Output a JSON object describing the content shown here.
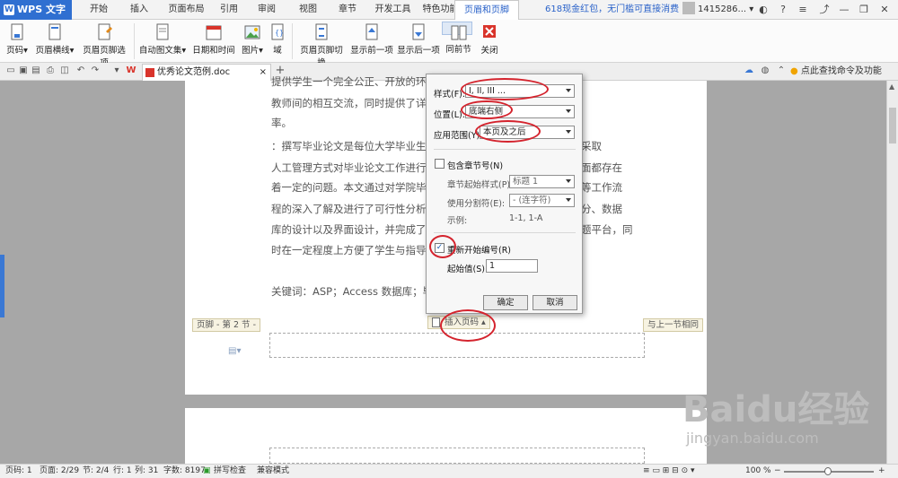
{
  "app": {
    "name": "WPS 文字",
    "promo": "618现金红包，无门槛可直接消费",
    "user": "1415286..."
  },
  "menu_tabs": [
    "开始",
    "插入",
    "页面布局",
    "引用",
    "审阅",
    "视图",
    "章节",
    "开发工具",
    "特色功能",
    "页眉和页脚"
  ],
  "ribbon": {
    "page_num": "页码",
    "header_line": "页眉横线",
    "hf_options": "页眉页脚选项",
    "auto_text": "自动图文集",
    "datetime": "日期和时间",
    "picture": "图片",
    "field": "域",
    "hf_switch": "页眉页脚切换",
    "show_prev": "显示前一项",
    "show_next": "显示后一项",
    "same_prev": "同前节",
    "close": "关闭"
  },
  "tabbar": {
    "doc_title": "优秀论文范例.doc",
    "search": "点此查找命令及功能"
  },
  "document": {
    "lines": [
      "提供学生一个完全公正、开放的环境，同时促进了学生与指导",
      "教师间的相互交流，同时提供了详细的工作流程，与服务人员工作效",
      "率。",
      "：撰写毕业论文是每位大学毕业生必须完成的任务，但目前高校普遍采取",
      "人工管理方式对毕业论文工作进行管理，在诸多环节方面和时效性方面都存在",
      "着一定的问题。本文通过对学院毕业论文选题管理、审核、资料备份等工作流",
      "程的深入了解及进行了可行性分析，对系统的需求进行分析、模块划分、数据",
      "库的设计以及界面设计，并完成了基于互联网的毕业设计（论文）选题平台，同",
      "时在一定程度上方便了学生与指导教师之间的交流。",
      "关键词：ASP；Access 数据库；毕业论文选题"
    ],
    "footer_tag": "页脚 - 第 2 节 -",
    "insert_page_num": "插入页码",
    "same_as_prev": "与上一节相同"
  },
  "dialog": {
    "style_label": "样式(F):",
    "style_value": "I, II, III ...",
    "position_label": "位置(L):",
    "position_value": "底端右侧",
    "scope_label": "应用范围(Y):",
    "scope_value": "本页及之后",
    "include_chapter": "包含章节号(N)",
    "chapter_style_label": "章节起始样式(P):",
    "chapter_style_value": "标题 1",
    "separator_label": "使用分割符(E):",
    "separator_value": "-  (连字符)",
    "example_label": "示例:",
    "example_value": "1-1, 1-A",
    "restart": "重新开始编号(R)",
    "start_label": "起始值(S):",
    "start_value": "1",
    "ok": "确定",
    "cancel": "取消"
  },
  "status": {
    "page_num": "页码: 1",
    "pages": "页面: 2/29",
    "section": "节: 2/4",
    "row": "行: 1",
    "col": "列: 31",
    "words": "字数: 8197",
    "spell": "拼写检查",
    "compat": "兼容模式",
    "zoom": "100 %"
  },
  "watermark": {
    "brand": "Baidu经验",
    "url": "jingyan.baidu.com"
  },
  "colors": {
    "accent": "#2f6fd1",
    "highlight_ring": "#d4232d"
  }
}
